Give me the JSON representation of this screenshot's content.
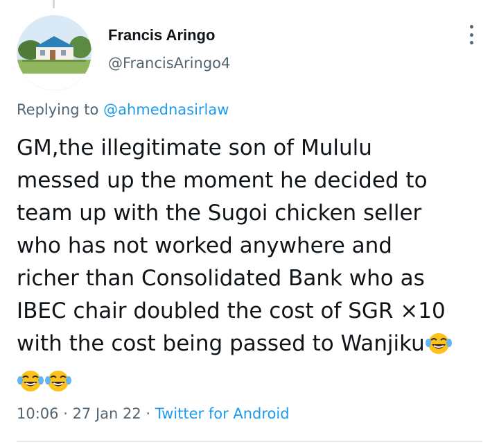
{
  "author": {
    "display_name": "Francis Aringo",
    "handle": "@FrancisAringo4"
  },
  "reply": {
    "prefix": "Replying to ",
    "to": "@ahmednasirlaw"
  },
  "tweet": {
    "lines": [
      "GM,the illegitimate son of Mululu",
      "messed up the moment he decided to",
      "team up with the Sugoi chicken seller",
      "who has not worked anywhere and",
      "richer than Consolidated Bank who as",
      "IBEC chair doubled the cost of SGR ×10",
      "with the cost being passed to Wanjiku"
    ],
    "emoji_count": 3,
    "emoji_name": "face-with-tears-of-joy"
  },
  "meta": {
    "time": "10:06",
    "sep1": " · ",
    "date": "27 Jan 22",
    "sep2": " · ",
    "source": "Twitter for Android"
  },
  "colors": {
    "text": "#0f1419",
    "secondary": "#536471",
    "link": "#1d9bf0",
    "divider": "#cfd9de"
  }
}
